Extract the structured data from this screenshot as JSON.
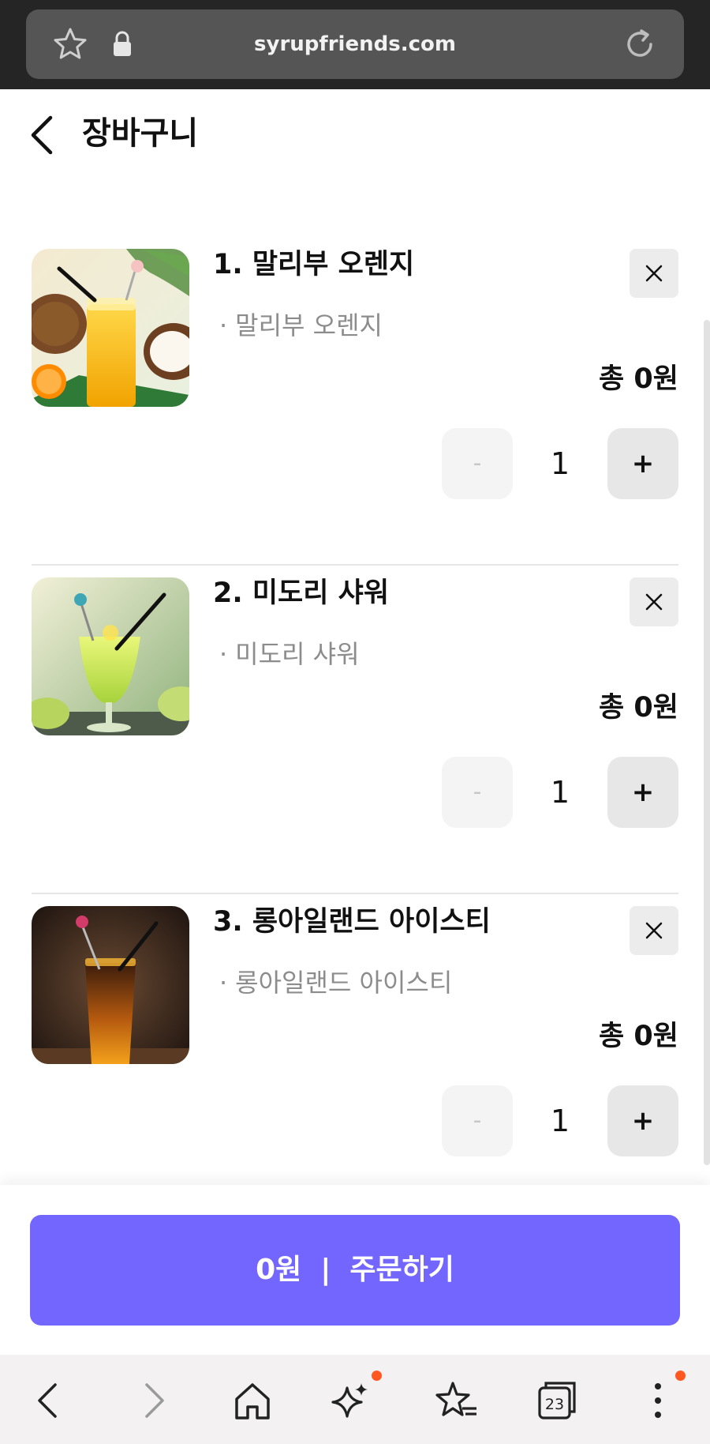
{
  "browser": {
    "url": "syrupfriends.com",
    "tabs_count": "23"
  },
  "header": {
    "title": "장바구니"
  },
  "cart": {
    "items": [
      {
        "name": "1. 말리부 오렌지",
        "option": "말리부 오렌지",
        "total": "총 0원",
        "quantity": "1",
        "minus_label": "-",
        "plus_label": "+",
        "image": "orange-coconut-drink"
      },
      {
        "name": "2. 미도리 샤워",
        "option": "미도리 샤워",
        "total": "총 0원",
        "quantity": "1",
        "minus_label": "-",
        "plus_label": "+",
        "image": "melon-green-drink"
      },
      {
        "name": "3. 롱아일랜드 아이스티",
        "option": "롱아일랜드 아이스티",
        "total": "총 0원",
        "quantity": "1",
        "minus_label": "-",
        "plus_label": "+",
        "image": "iced-tea-drink"
      }
    ]
  },
  "order": {
    "amount": "0원",
    "separator": "|",
    "label": "주문하기"
  },
  "colors": {
    "accent": "#7366ff",
    "browser_chrome": "#252525",
    "notification_dot": "#ff5722"
  }
}
